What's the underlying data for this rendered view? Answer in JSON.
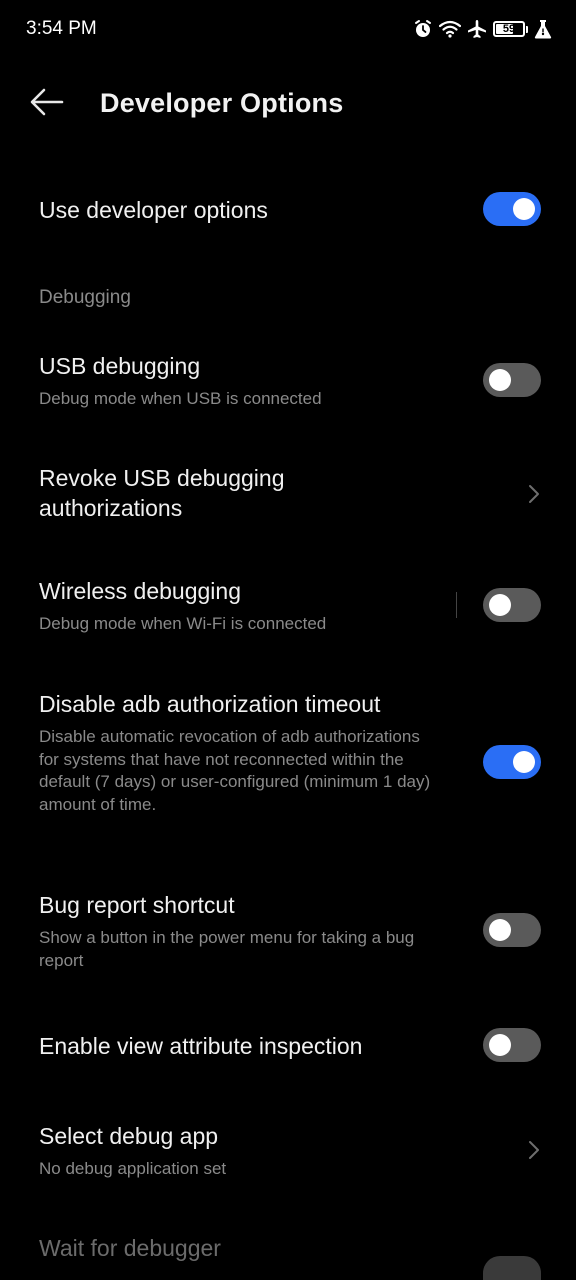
{
  "status_bar": {
    "time": "3:54 PM",
    "battery_level": "59",
    "icons": [
      "alarm-icon",
      "wifi-icon",
      "airplane-icon",
      "battery-icon",
      "flask-icon"
    ]
  },
  "header": {
    "title": "Developer Options",
    "back_icon": "back-arrow-icon"
  },
  "master": {
    "title": "Use developer options",
    "enabled": true
  },
  "section": {
    "label": "Debugging"
  },
  "items": [
    {
      "title": "USB debugging",
      "subtitle": "Debug mode when USB is connected",
      "control": "toggle",
      "enabled": false
    },
    {
      "title": "Revoke USB debugging authorizations",
      "control": "chevron"
    },
    {
      "title": "Wireless debugging",
      "subtitle": "Debug mode when Wi-Fi is connected",
      "control": "toggle",
      "enabled": false
    },
    {
      "title": "Disable adb authorization timeout",
      "subtitle": "Disable automatic revocation of adb authorizations for systems that have not reconnected within the default (7 days) or user-configured (minimum 1 day) amount of time.",
      "control": "toggle",
      "enabled": true
    },
    {
      "title": "Bug report shortcut",
      "subtitle": "Show a button in the power menu for taking a bug report",
      "control": "toggle",
      "enabled": false
    },
    {
      "title": "Enable view attribute inspection",
      "control": "toggle",
      "enabled": false
    },
    {
      "title": "Select debug app",
      "subtitle": "No debug application set",
      "control": "chevron"
    },
    {
      "title": "Wait for debugger",
      "control": "toggle",
      "enabled": false
    }
  ],
  "colors": {
    "background": "#000000",
    "accent": "#2a6ef5",
    "toggle_off": "#5a5a5a",
    "secondary_text": "#8a8a8a"
  }
}
